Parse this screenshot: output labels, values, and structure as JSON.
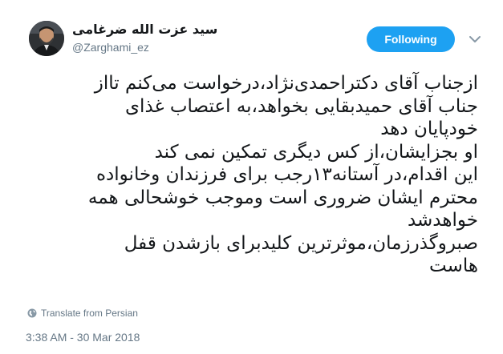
{
  "colors": {
    "accent": "#1da1f2",
    "text": "#14171a",
    "secondary_text": "#657786"
  },
  "author": {
    "display_name": "سید عزت الله ضرغامی",
    "screen_name": "@Zarghami_ez",
    "avatar_icon": "profile-photo"
  },
  "follow_button": {
    "label": "Following"
  },
  "menu": {
    "icon": "chevron-down-icon"
  },
  "tweet": {
    "lines": [
      "ازجناب آقای دکتراحمدی‌نژاد،درخواست می‌کنم تااز",
      "جناب آقای حمیدبقایی بخواهد،به اعتصاب غذای",
      "خودپایان دهد",
      "او بجزایشان،از کس دیگری تمکین نمی کند",
      "این اقدام،در آستانه۱۳رجب برای فرزندان وخانواده",
      "محترم ایشان ضروری است وموجب خوشحالی همه",
      "خواهدشد",
      "صبروگذرزمان،موثرترین کلیدبرای بازشدن قفل",
      "هاست"
    ]
  },
  "translate": {
    "label": "Translate from Persian",
    "icon": "globe-icon"
  },
  "timestamp": "3:38 AM - 30 Mar 2018"
}
